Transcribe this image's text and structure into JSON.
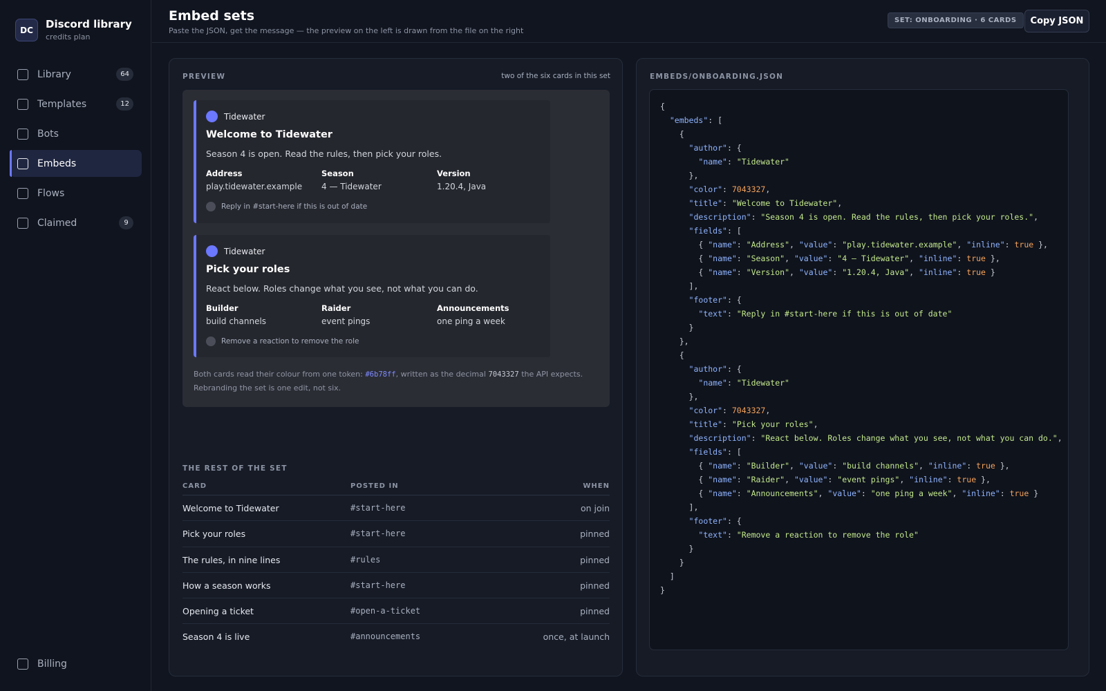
{
  "brand": {
    "logo": "DC",
    "name": "Discord library",
    "plan": "credits plan"
  },
  "nav": [
    {
      "label": "Library",
      "count": "64",
      "active": false
    },
    {
      "label": "Templates",
      "count": "12",
      "active": false
    },
    {
      "label": "Bots",
      "count": null,
      "active": false
    },
    {
      "label": "Embeds",
      "count": null,
      "active": true
    },
    {
      "label": "Flows",
      "count": null,
      "active": false
    },
    {
      "label": "Claimed",
      "count": "9",
      "active": false
    }
  ],
  "nav_bottom": {
    "label": "Billing"
  },
  "header": {
    "title": "Embed sets",
    "subtitle": "Paste the JSON, get the message — the preview on the left is drawn from the file on the right",
    "set_badge": "SET: ONBOARDING · 6 CARDS",
    "copy_label": "Copy JSON"
  },
  "preview": {
    "label": "PREVIEW",
    "note": "two of the six cards in this set",
    "accent_color": "#6b78ff",
    "embeds": [
      {
        "author": "Tidewater",
        "title": "Welcome to Tidewater",
        "description": "Season 4 is open. Read the rules, then pick your roles.",
        "fields": [
          {
            "name": "Address",
            "value": "play.tidewater.example"
          },
          {
            "name": "Season",
            "value": "4 — Tidewater"
          },
          {
            "name": "Version",
            "value": "1.20.4, Java"
          }
        ],
        "footer": "Reply in #start-here if this is out of date"
      },
      {
        "author": "Tidewater",
        "title": "Pick your roles",
        "description": "React below. Roles change what you see, not what you can do.",
        "fields": [
          {
            "name": "Builder",
            "value": "build channels"
          },
          {
            "name": "Raider",
            "value": "event pings"
          },
          {
            "name": "Announcements",
            "value": "one ping a week"
          }
        ],
        "footer": "Remove a reaction to remove the role"
      }
    ],
    "note_text": {
      "part1": "Both cards read their colour from one token: ",
      "hex": "#6b78ff",
      "part2": ", written as the decimal ",
      "decimal": "7043327",
      "part3": " the API expects. Rebranding the set is one edit, not six."
    }
  },
  "rest": {
    "label": "THE REST OF THE SET",
    "columns": [
      "CARD",
      "POSTED IN",
      "WHEN"
    ],
    "rows": [
      {
        "card": "Welcome to Tidewater",
        "channel": "#start-here",
        "when": "on join"
      },
      {
        "card": "Pick your roles",
        "channel": "#start-here",
        "when": "pinned"
      },
      {
        "card": "The rules, in nine lines",
        "channel": "#rules",
        "when": "pinned"
      },
      {
        "card": "How a season works",
        "channel": "#start-here",
        "when": "pinned"
      },
      {
        "card": "Opening a ticket",
        "channel": "#open-a-ticket",
        "when": "pinned"
      },
      {
        "card": "Season 4 is live",
        "channel": "#announcements",
        "when": "once, at launch"
      }
    ]
  },
  "file": {
    "label": "EMBEDS/ONBOARDING.JSON",
    "embeds": [
      {
        "author_name": "Tidewater",
        "color": "7043327",
        "title": "Welcome to Tidewater",
        "description": "Season 4 is open. Read the rules, then pick your roles.",
        "fields": [
          {
            "name": "Address",
            "value": "play.tidewater.example",
            "inline": "true"
          },
          {
            "name": "Season",
            "value": "4 — Tidewater",
            "inline": "true"
          },
          {
            "name": "Version",
            "value": "1.20.4, Java",
            "inline": "true"
          }
        ],
        "footer_text": "Reply in #start-here if this is out of date"
      },
      {
        "author_name": "Tidewater",
        "color": "7043327",
        "title": "Pick your roles",
        "description": "React below. Roles change what you see, not what you can do.",
        "fields": [
          {
            "name": "Builder",
            "value": "build channels",
            "inline": "true"
          },
          {
            "name": "Raider",
            "value": "event pings",
            "inline": "true"
          },
          {
            "name": "Announcements",
            "value": "one ping a week",
            "inline": "true"
          }
        ],
        "footer_text": "Remove a reaction to remove the role"
      }
    ]
  }
}
